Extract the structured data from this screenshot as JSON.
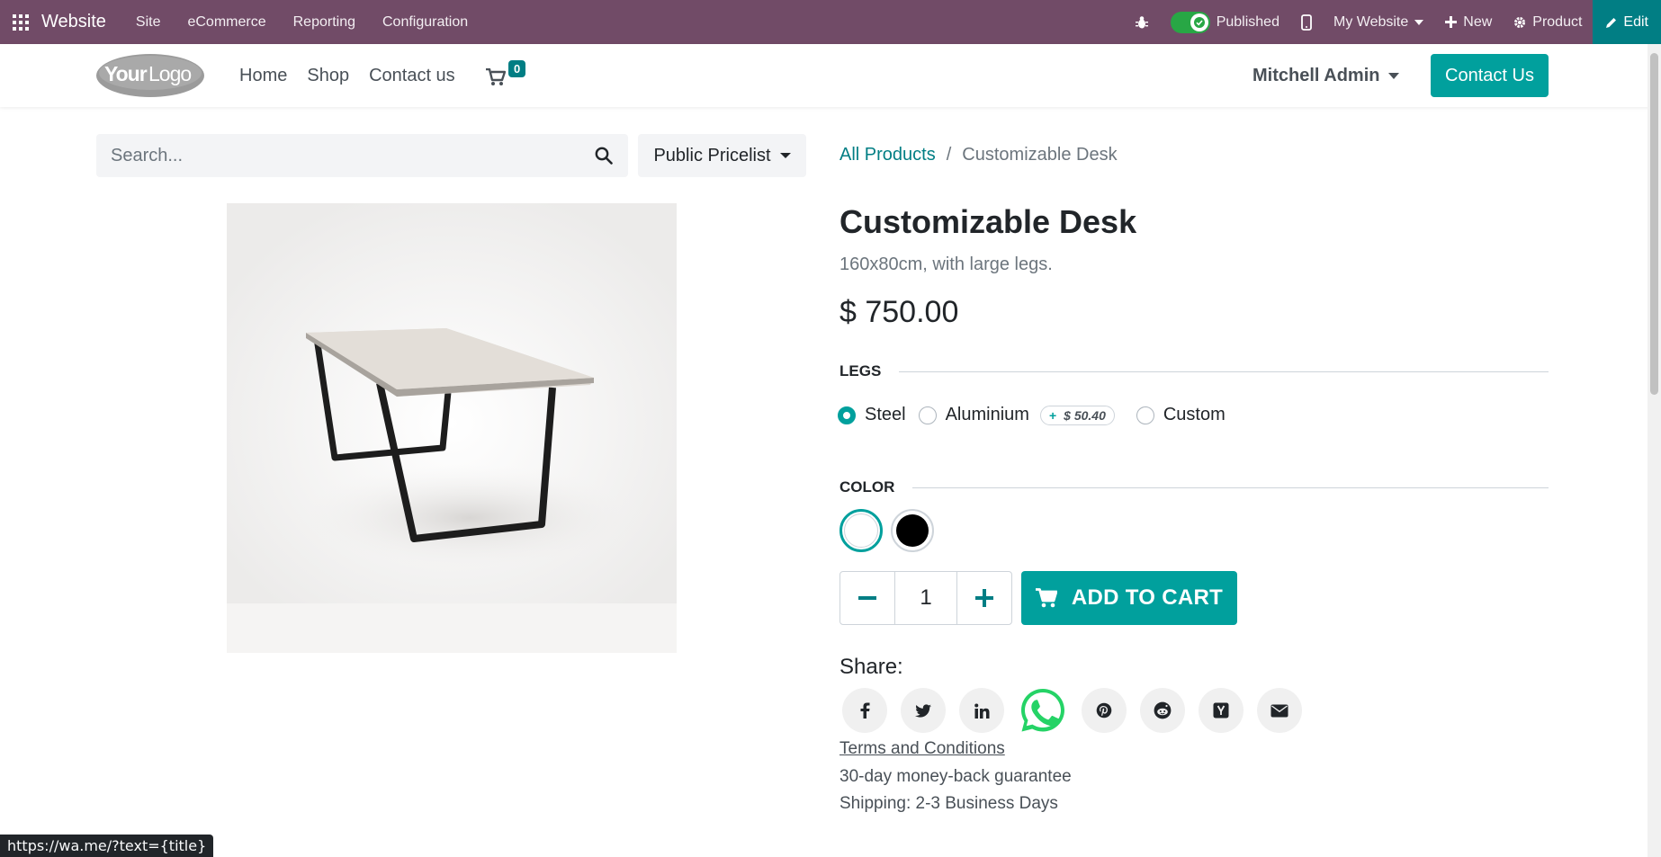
{
  "adminbar": {
    "app_name": "Website",
    "menu": [
      "Site",
      "eCommerce",
      "Reporting",
      "Configuration"
    ],
    "published_label": "Published",
    "website_label": "My Website",
    "new_label": "New",
    "product_label": "Product",
    "edit_label": "Edit",
    "background_color": "#714b67"
  },
  "header": {
    "logo_text": "YourLogo",
    "nav": [
      "Home",
      "Shop",
      "Contact us"
    ],
    "cart_count": "0",
    "user_name": "Mitchell Admin",
    "contact_button": "Contact Us",
    "accent_color": "#01a09d"
  },
  "search": {
    "placeholder": "Search...",
    "value": ""
  },
  "pricelist": {
    "label": "Public Pricelist"
  },
  "breadcrumb": {
    "parent": "All Products",
    "separator": "/",
    "current": "Customizable Desk"
  },
  "product": {
    "name": "Customizable Desk",
    "description": "160x80cm, with large legs.",
    "price": "$ 750.00",
    "attributes": {
      "legs": {
        "title": "LEGS",
        "options": [
          {
            "label": "Steel",
            "selected": true,
            "extra": ""
          },
          {
            "label": "Aluminium",
            "selected": false,
            "extra": "$ 50.40"
          },
          {
            "label": "Custom",
            "selected": false,
            "extra": ""
          }
        ],
        "extra_prefix": "+"
      },
      "color": {
        "title": "COLOR",
        "options": [
          {
            "name": "white",
            "color": "#ffffff",
            "selected": true
          },
          {
            "name": "black",
            "color": "#000000",
            "selected": false
          }
        ]
      }
    },
    "quantity": "1",
    "add_to_cart": "ADD TO CART"
  },
  "share": {
    "label": "Share:",
    "networks": [
      "facebook-icon",
      "twitter-icon",
      "linkedin-icon",
      "whatsapp-icon",
      "pinterest-icon",
      "reddit-icon",
      "hacker-news-icon",
      "email-icon"
    ]
  },
  "footer_info": {
    "terms": "Terms and Conditions",
    "guarantee": "30-day money-back guarantee",
    "shipping": "Shipping: 2-3 Business Days"
  },
  "status_bar": {
    "url": "https://wa.me/?text={title}"
  }
}
